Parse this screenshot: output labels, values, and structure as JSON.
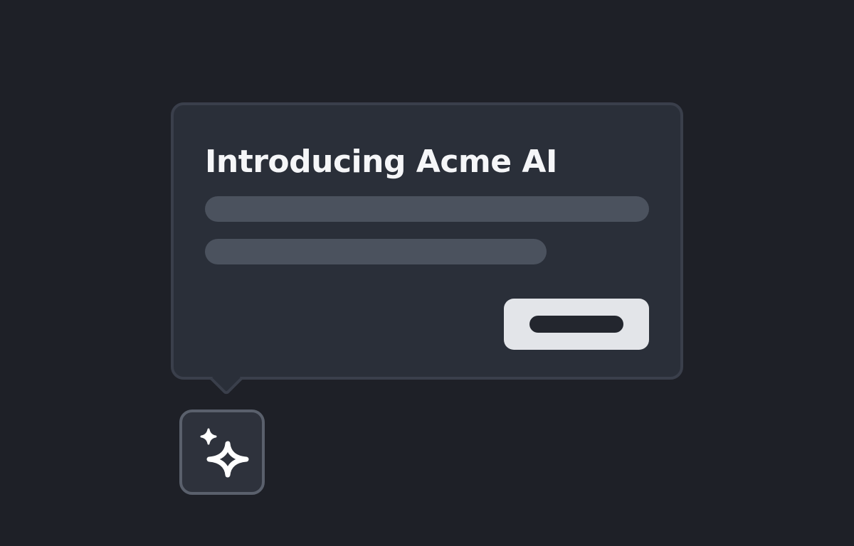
{
  "popover": {
    "title": "Introducing Acme AI"
  },
  "ai_trigger": {
    "icon": "sparkles-icon"
  },
  "colors": {
    "background": "#1e2027",
    "popover_bg": "#2a2f39",
    "popover_border": "#3a3f4b",
    "skeleton": "#4b525e",
    "button_bg": "#e3e5e9",
    "title_text": "#f5f6f8"
  }
}
